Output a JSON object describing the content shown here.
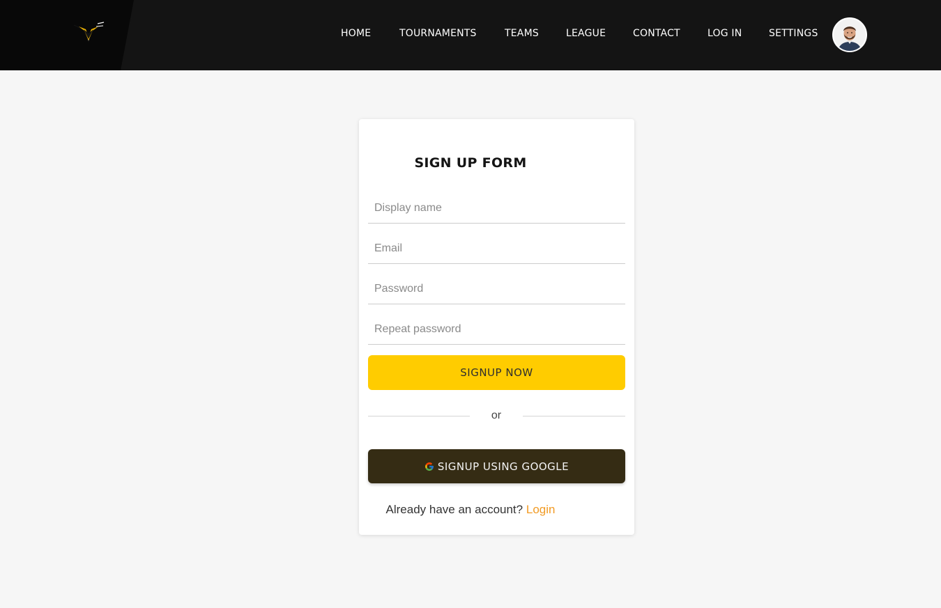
{
  "nav": {
    "items": [
      {
        "label": "HOME"
      },
      {
        "label": "TOURNAMENTS"
      },
      {
        "label": "TEAMS"
      },
      {
        "label": "LEAGUE"
      },
      {
        "label": "CONTACT"
      },
      {
        "label": "LOG IN"
      },
      {
        "label": "SETTINGS"
      }
    ]
  },
  "form": {
    "title": "SIGN UP FORM",
    "display_name": {
      "placeholder": "Display name",
      "value": ""
    },
    "email": {
      "placeholder": "Email",
      "value": ""
    },
    "password": {
      "placeholder": "Password",
      "value": ""
    },
    "repeat_password": {
      "placeholder": "Repeat password",
      "value": ""
    },
    "signup_label": "SIGNUP NOW",
    "divider_text": "or",
    "google_label": "SIGNUP USING GOOGLE",
    "google_icon": "google-icon",
    "account_prompt": "Already have an account?",
    "login_label": "Login"
  },
  "colors": {
    "header_bg": "#141414",
    "primary_button": "#ffcc00",
    "google_button": "#352c14",
    "link": "#f29b24",
    "page_bg": "#f6f6f6"
  }
}
